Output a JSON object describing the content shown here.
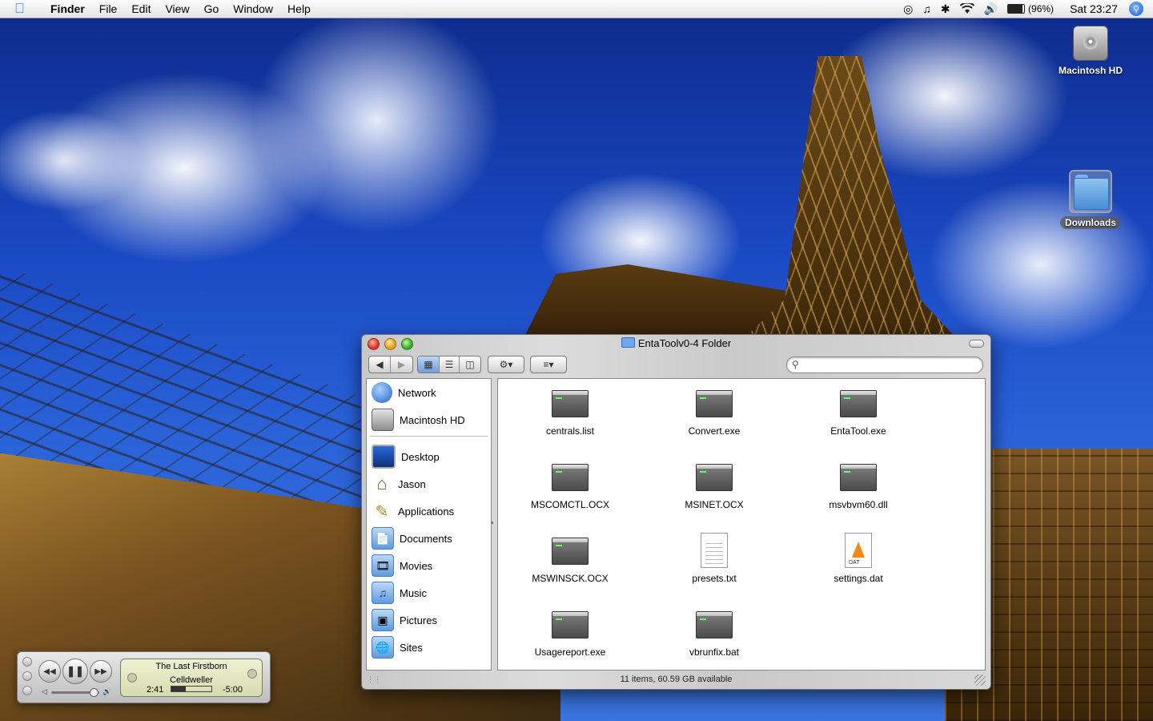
{
  "menubar": {
    "app_name": "Finder",
    "menus": [
      "File",
      "Edit",
      "View",
      "Go",
      "Window",
      "Help"
    ],
    "battery": "(96%)",
    "clock": "Sat 23:27"
  },
  "desktop": {
    "icons": [
      {
        "label": "Macintosh HD"
      },
      {
        "label": "Downloads"
      }
    ]
  },
  "finder": {
    "title": "EntaToolv0-4 Folder",
    "search": {
      "value": "",
      "placeholder": ""
    },
    "sidebar": {
      "devices": [
        {
          "label": "Network",
          "icon": "network-globe-icon"
        },
        {
          "label": "Macintosh HD",
          "icon": "hard-drive-icon"
        }
      ],
      "places": [
        {
          "label": "Desktop",
          "icon": "desktop-icon"
        },
        {
          "label": "Jason",
          "icon": "home-icon"
        },
        {
          "label": "Applications",
          "icon": "applications-icon"
        },
        {
          "label": "Documents",
          "icon": "documents-icon"
        },
        {
          "label": "Movies",
          "icon": "movies-icon"
        },
        {
          "label": "Music",
          "icon": "music-icon"
        },
        {
          "label": "Pictures",
          "icon": "pictures-icon"
        },
        {
          "label": "Sites",
          "icon": "sites-icon"
        }
      ]
    },
    "files": [
      {
        "name": "centrals.list",
        "kind": "exec"
      },
      {
        "name": "Convert.exe",
        "kind": "exec"
      },
      {
        "name": "EntaTool.exe",
        "kind": "exec"
      },
      {
        "name": "MSCOMCTL.OCX",
        "kind": "exec"
      },
      {
        "name": "MSINET.OCX",
        "kind": "exec"
      },
      {
        "name": "msvbvm60.dll",
        "kind": "exec"
      },
      {
        "name": "MSWINSCK.OCX",
        "kind": "exec"
      },
      {
        "name": "presets.txt",
        "kind": "text"
      },
      {
        "name": "settings.dat",
        "kind": "dat"
      },
      {
        "name": "Usagereport.exe",
        "kind": "exec"
      },
      {
        "name": "vbrunfix.bat",
        "kind": "exec"
      }
    ],
    "status": "11 items, 60.59 GB available"
  },
  "itunes": {
    "track": "The Last Firstborn",
    "artist": "Celldweller",
    "elapsed": "2:41",
    "remaining": "-5:00",
    "progress": 0.35
  }
}
